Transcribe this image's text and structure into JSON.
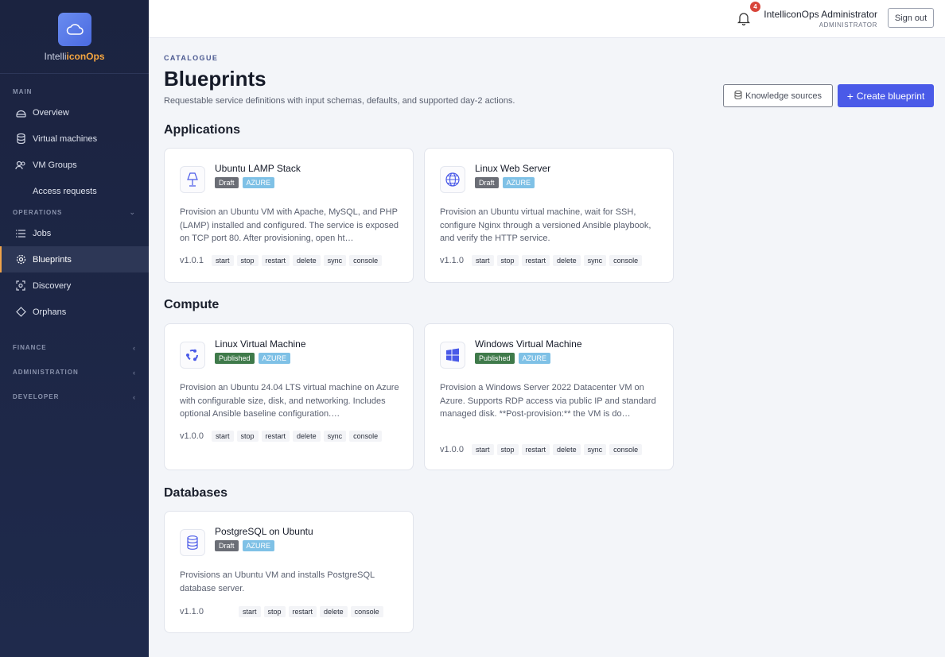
{
  "brand": {
    "prefix": "Intelli",
    "accent": "iconOps"
  },
  "sidebar": {
    "main_label": "MAIN",
    "items_main": [
      {
        "label": "Overview",
        "icon": "dashboard-icon"
      },
      {
        "label": "Virtual machines",
        "icon": "database-icon"
      },
      {
        "label": "VM Groups",
        "icon": "users-icon"
      },
      {
        "label": "Access requests",
        "icon": ""
      }
    ],
    "operations_label": "OPERATIONS",
    "items_ops": [
      {
        "label": "Jobs",
        "icon": "list-icon"
      },
      {
        "label": "Blueprints",
        "icon": "gear-icon"
      },
      {
        "label": "Discovery",
        "icon": "scan-icon"
      },
      {
        "label": "Orphans",
        "icon": "diamond-icon"
      }
    ],
    "finance_label": "FINANCE",
    "administration_label": "ADMINISTRATION",
    "developer_label": "DEVELOPER"
  },
  "topbar": {
    "notification_count": "4",
    "user_name": "IntelliconOps Administrator",
    "user_role": "ADMINISTRATOR",
    "signout_label": "Sign out"
  },
  "header": {
    "eyebrow": "CATALOGUE",
    "title": "Blueprints",
    "subtitle": "Requestable service definitions with input schemas, defaults, and supported day-2 actions.",
    "knowledge_label": "Knowledge sources",
    "create_label": "Create blueprint"
  },
  "sections": {
    "applications": "Applications",
    "compute": "Compute",
    "databases": "Databases"
  },
  "cards": [
    {
      "name": "Ubuntu LAMP Stack",
      "status": "Draft",
      "cloud": "AZURE",
      "icon": "lamp-icon",
      "desc": "Provision an Ubuntu VM with Apache, MySQL, and PHP (LAMP) installed and configured. The service is exposed on TCP port 80. After provisioning, open ht…",
      "version": "v1.0.1",
      "actions": [
        "start",
        "stop",
        "restart",
        "delete",
        "sync",
        "console"
      ]
    },
    {
      "name": "Linux Web Server",
      "status": "Draft",
      "cloud": "AZURE",
      "icon": "globe-icon",
      "desc": "Provision an Ubuntu virtual machine, wait for SSH, configure Nginx through a versioned Ansible playbook, and verify the HTTP service.",
      "version": "v1.1.0",
      "actions": [
        "start",
        "stop",
        "restart",
        "delete",
        "sync",
        "console"
      ]
    },
    {
      "name": "Linux Virtual Machine",
      "status": "Published",
      "cloud": "AZURE",
      "icon": "ubuntu-icon",
      "desc": "Provision an Ubuntu 24.04 LTS virtual machine on Azure with configurable size, disk, and networking. Includes optional Ansible baseline configuration.…",
      "version": "v1.0.0",
      "actions": [
        "start",
        "stop",
        "restart",
        "delete",
        "sync",
        "console"
      ]
    },
    {
      "name": "Windows Virtual Machine",
      "status": "Published",
      "cloud": "AZURE",
      "icon": "windows-icon",
      "desc": "Provision a Windows Server 2022 Datacenter VM on Azure. Supports RDP access via public IP and standard managed disk. **Post-provision:** the VM is do…",
      "version": "v1.0.0",
      "actions": [
        "start",
        "stop",
        "restart",
        "delete",
        "sync",
        "console"
      ]
    },
    {
      "name": "PostgreSQL on Ubuntu",
      "status": "Draft",
      "cloud": "AZURE",
      "icon": "database-icon",
      "desc": "Provisions an Ubuntu VM and installs PostgreSQL database server.",
      "version": "v1.1.0",
      "actions": [
        "start",
        "stop",
        "restart",
        "delete",
        "console"
      ]
    }
  ],
  "colors": {
    "accent": "#4a5ae8",
    "sidebar": "#1b2340",
    "published": "#3f7a4a",
    "draft": "#6b6e76",
    "azure": "#7fc1e6"
  }
}
